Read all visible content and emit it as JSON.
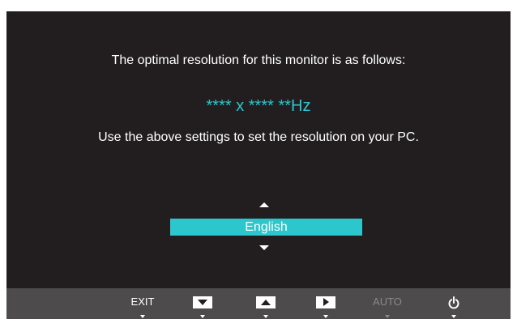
{
  "message": {
    "line1": "The optimal resolution for this monitor is as follows:",
    "resolution": "**** x **** **Hz",
    "line2": "Use the above settings to set the resolution on your PC."
  },
  "language": {
    "selected": "English"
  },
  "bottom_bar": {
    "exit_label": "EXIT",
    "auto_label": "AUTO",
    "buttons": [
      {
        "name": "exit",
        "icon": "text",
        "enabled": true
      },
      {
        "name": "down",
        "icon": "triangle-down-icon",
        "enabled": true
      },
      {
        "name": "up",
        "icon": "triangle-up-icon",
        "enabled": true
      },
      {
        "name": "right",
        "icon": "triangle-right-icon",
        "enabled": true
      },
      {
        "name": "auto",
        "icon": "text",
        "enabled": false
      },
      {
        "name": "power",
        "icon": "power-icon",
        "enabled": true
      }
    ]
  },
  "colors": {
    "background": "#221e1f",
    "accent": "#2cc7cd",
    "bar": "#4e4b4c",
    "disabled": "#8b8889"
  }
}
